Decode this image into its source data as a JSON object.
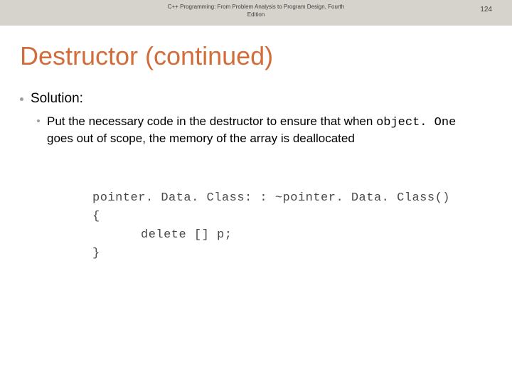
{
  "header": {
    "book_title": "C++ Programming: From Problem Analysis to Program Design, Fourth Edition",
    "page_number": "124"
  },
  "slide": {
    "title": "Destructor (continued)",
    "bullets": {
      "level1": "Solution:",
      "level2_pre": "Put the necessary code in the destructor to ensure that when ",
      "level2_code": "object. One",
      "level2_post": " goes out of scope, the memory of the array is deallocated"
    }
  },
  "code": {
    "line1": "pointer. Data. Class: : ~pointer. Data. Class()",
    "line2": "{",
    "line3": "delete [] p;",
    "line4": "}"
  }
}
